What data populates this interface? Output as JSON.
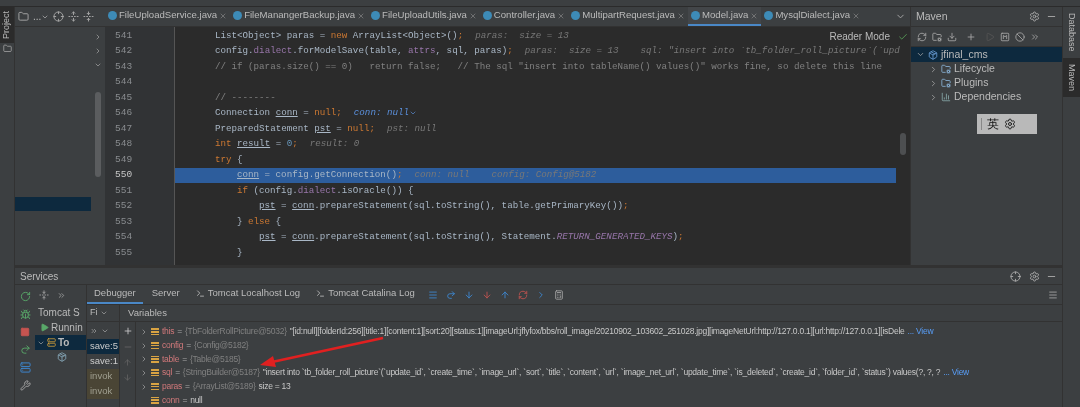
{
  "project_panel": {
    "toolbar_label": "..."
  },
  "left_tool_tabs": [
    {
      "label": "Project",
      "selected": true
    }
  ],
  "editor_tabs": [
    {
      "label": "FileUploadService.java",
      "selected": false
    },
    {
      "label": "FileManangerBackup.java",
      "selected": false
    },
    {
      "label": "FileUploadUtils.java",
      "selected": false
    },
    {
      "label": "Controller.java",
      "selected": false
    },
    {
      "label": "MultipartRequest.java",
      "selected": false
    },
    {
      "label": "Model.java",
      "selected": true
    },
    {
      "label": "MysqlDialect.java",
      "selected": false
    }
  ],
  "editor": {
    "reader_mode": "Reader Mode",
    "lines": [
      {
        "number": "541",
        "current": false,
        "tokens": [
          {
            "kind": "plain",
            "text": "List<Object> paras = "
          },
          {
            "kind": "keyword",
            "text": "new"
          },
          {
            "kind": "plain",
            "text": " ArrayList<Object>()"
          },
          {
            "kind": "keyword",
            "text": ";"
          },
          {
            "kind": "hint",
            "text": "paras:  size = 13"
          }
        ]
      },
      {
        "number": "542",
        "current": false,
        "tokens": [
          {
            "kind": "plain",
            "text": "config."
          },
          {
            "kind": "field",
            "text": "dialect"
          },
          {
            "kind": "plain",
            "text": ".forModelSave(table, "
          },
          {
            "kind": "field",
            "text": "attrs"
          },
          {
            "kind": "plain",
            "text": ", sql, paras)"
          },
          {
            "kind": "keyword",
            "text": ";"
          },
          {
            "kind": "hint",
            "text": "paras:  size = 13    sql: \"insert into `tb_folder_roll_picture`(`upd"
          }
        ]
      },
      {
        "number": "543",
        "current": false,
        "tokens": [
          {
            "kind": "comment",
            "text": "// if (paras.size() == 0)   return false;   // The sql \"insert into tableName() values()\" works fine, so delete this line"
          }
        ]
      },
      {
        "number": "544",
        "current": false
      },
      {
        "number": "545",
        "current": false,
        "tokens": [
          {
            "kind": "comment",
            "text": "// --------"
          }
        ]
      },
      {
        "number": "546",
        "current": false,
        "tokens": [
          {
            "kind": "plain",
            "text": "Connection "
          },
          {
            "kind": "var",
            "text": "conn"
          },
          {
            "kind": "plain",
            "text": " = "
          },
          {
            "kind": "keyword",
            "text": "null;"
          },
          {
            "kind": "hint_active",
            "text": "conn: null"
          }
        ]
      },
      {
        "number": "547",
        "current": false,
        "tokens": [
          {
            "kind": "plain",
            "text": "PreparedStatement "
          },
          {
            "kind": "var",
            "text": "pst"
          },
          {
            "kind": "plain",
            "text": " = "
          },
          {
            "kind": "keyword",
            "text": "null;"
          },
          {
            "kind": "hint",
            "text": "pst: null"
          }
        ]
      },
      {
        "number": "548",
        "current": false,
        "tokens": [
          {
            "kind": "keyword",
            "text": "int "
          },
          {
            "kind": "var",
            "text": "result"
          },
          {
            "kind": "plain",
            "text": " = "
          },
          {
            "kind": "number",
            "text": "0"
          },
          {
            "kind": "keyword",
            "text": ";"
          },
          {
            "kind": "hint",
            "text": "result: 0"
          }
        ]
      },
      {
        "number": "549",
        "current": false,
        "tokens": [
          {
            "kind": "keyword",
            "text": "try"
          },
          {
            "kind": "plain",
            "text": " {"
          }
        ],
        "children": [
          {
            "number": "550",
            "current": true,
            "tokens": [
              {
                "kind": "var",
                "text": "conn"
              },
              {
                "kind": "plain",
                "text": " = config.getConnection()"
              },
              {
                "kind": "keyword",
                "text": ";"
              },
              {
                "kind": "hint",
                "text": "conn: null    config: Config@5182"
              }
            ]
          },
          {
            "number": "551",
            "current": false,
            "tokens": [
              {
                "kind": "keyword",
                "text": "if"
              },
              {
                "kind": "plain",
                "text": " (config."
              },
              {
                "kind": "field",
                "text": "dialect"
              },
              {
                "kind": "plain",
                "text": ".isOracle()) {"
              }
            ],
            "children": [
              {
                "number": "552",
                "current": false,
                "tokens": [
                  {
                    "kind": "var",
                    "text": "pst"
                  },
                  {
                    "kind": "plain",
                    "text": " = "
                  },
                  {
                    "kind": "var",
                    "text": "conn"
                  },
                  {
                    "kind": "plain",
                    "text": ".prepareStatement(sql.toString(), table.getPrimaryKey())"
                  },
                  {
                    "kind": "keyword",
                    "text": ";"
                  }
                ]
              }
            ]
          },
          {
            "number": "553",
            "current": false,
            "tokens": [
              {
                "kind": "plain",
                "text": "} "
              },
              {
                "kind": "keyword",
                "text": "else"
              },
              {
                "kind": "plain",
                "text": " {"
              }
            ],
            "children": [
              {
                "number": "554",
                "current": false,
                "tokens": [
                  {
                    "kind": "var",
                    "text": "pst"
                  },
                  {
                    "kind": "plain",
                    "text": " = "
                  },
                  {
                    "kind": "var",
                    "text": "conn"
                  },
                  {
                    "kind": "plain",
                    "text": ".prepareStatement(sql.toString(), Statement."
                  },
                  {
                    "kind": "constant",
                    "text": "RETURN_GENERATED_KEYS"
                  },
                  {
                    "kind": "plain",
                    "text": ")"
                  },
                  {
                    "kind": "keyword",
                    "text": ";"
                  }
                ]
              }
            ]
          },
          {
            "number": "555",
            "current": false,
            "tokens": [
              {
                "kind": "plain",
                "text": "}"
              }
            ]
          }
        ]
      }
    ]
  },
  "maven": {
    "title": "Maven",
    "tree": [
      {
        "label": "jfinal_cms",
        "kind": "project",
        "expanded": true,
        "selected": true,
        "children": [
          {
            "label": "Lifecycle",
            "kind": "folder",
            "expanded": false,
            "selected": false
          },
          {
            "label": "Plugins",
            "kind": "folder",
            "expanded": false,
            "selected": false
          },
          {
            "label": "Dependencies",
            "kind": "deps",
            "expanded": false,
            "selected": false
          }
        ]
      }
    ]
  },
  "ime_widget": {
    "label": "英"
  },
  "right_tool_tabs": [
    {
      "label": "Database",
      "selected": false
    },
    {
      "label": "Maven",
      "selected": true
    }
  ],
  "services": {
    "title": "Services",
    "tree": [
      {
        "kind": "group",
        "label": "Tomcat S",
        "selected": false
      },
      {
        "kind": "status",
        "label": "Runnin",
        "selected": false
      },
      {
        "kind": "server",
        "label": "To",
        "selected": true
      }
    ],
    "tabs": [
      {
        "kind": "plain",
        "label": "Debugger",
        "selected": true
      },
      {
        "kind": "plain",
        "label": "Server",
        "selected": false
      },
      {
        "kind": "console",
        "label": "Tomcat Localhost Log",
        "selected": false
      },
      {
        "kind": "console",
        "label": "Tomcat Catalina Log",
        "selected": false
      }
    ],
    "frames_filter": "Fi",
    "frames": [
      {
        "label": "save:5",
        "selected": true,
        "library": false
      },
      {
        "label": "save:1",
        "selected": false,
        "library": false
      },
      {
        "label": "invok",
        "selected": false,
        "library": true
      },
      {
        "label": "invok",
        "selected": false,
        "library": true
      }
    ],
    "variables_title": "Variables",
    "variables": [
      {
        "name": "this",
        "operator": "=",
        "expandable": true,
        "type": "{TbFolderRollPicture@5032}",
        "value": "\"[id:null][folderId:256][title:1][content:1][sort:20][status:1][imageUrl:jflyfox/bbs/roll_image/20210902_103602_251028.jpg][imageNetUrl:http://127.0.0.1][url:http://127.0.0.1][isDele",
        "link": "... View"
      },
      {
        "name": "config",
        "operator": "=",
        "expandable": true,
        "type": "{Config@5182}"
      },
      {
        "name": "table",
        "operator": "=",
        "expandable": true,
        "type": "{Table@5185}"
      },
      {
        "name": "sql",
        "operator": "=",
        "expandable": true,
        "type": "{StringBuilder@5187}",
        "value": "\"insert into `tb_folder_roll_picture`(`update_id`, `create_time`, `image_url`, `sort`, `title`, `content`, `url`, `image_net_url`, `update_time`, `is_deleted`, `create_id`, `folder_id`, `status`) values(?, ?, ?",
        "link": "... View"
      },
      {
        "name": "paras",
        "operator": "=",
        "expandable": true,
        "type": "{ArrayList@5189}",
        "value": "size = 13"
      },
      {
        "name": "conn",
        "operator": "=",
        "expandable": false,
        "value": "null"
      }
    ]
  }
}
